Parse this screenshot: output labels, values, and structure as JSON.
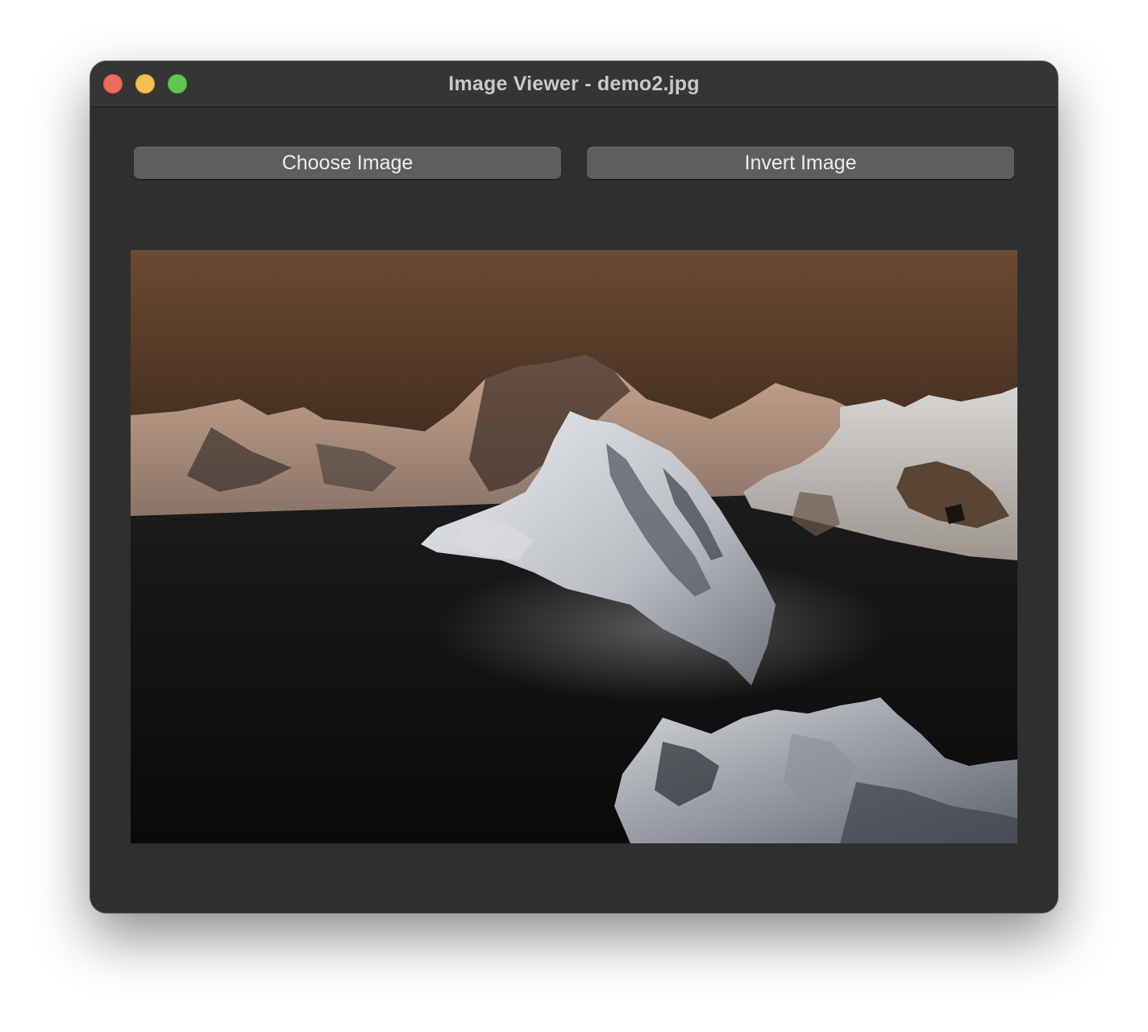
{
  "window": {
    "title": "Image Viewer - demo2.jpg"
  },
  "toolbar": {
    "choose_label": "Choose Image",
    "invert_label": "Invert Image"
  },
  "image": {
    "description_icon": "image-canvas"
  },
  "colors": {
    "window_bg": "#2f2f2f",
    "titlebar_bg": "#353535",
    "button_bg": "#5e5e5e",
    "close": "#ed6a5e",
    "minimize": "#f5bf4f",
    "maximize": "#61c554"
  }
}
